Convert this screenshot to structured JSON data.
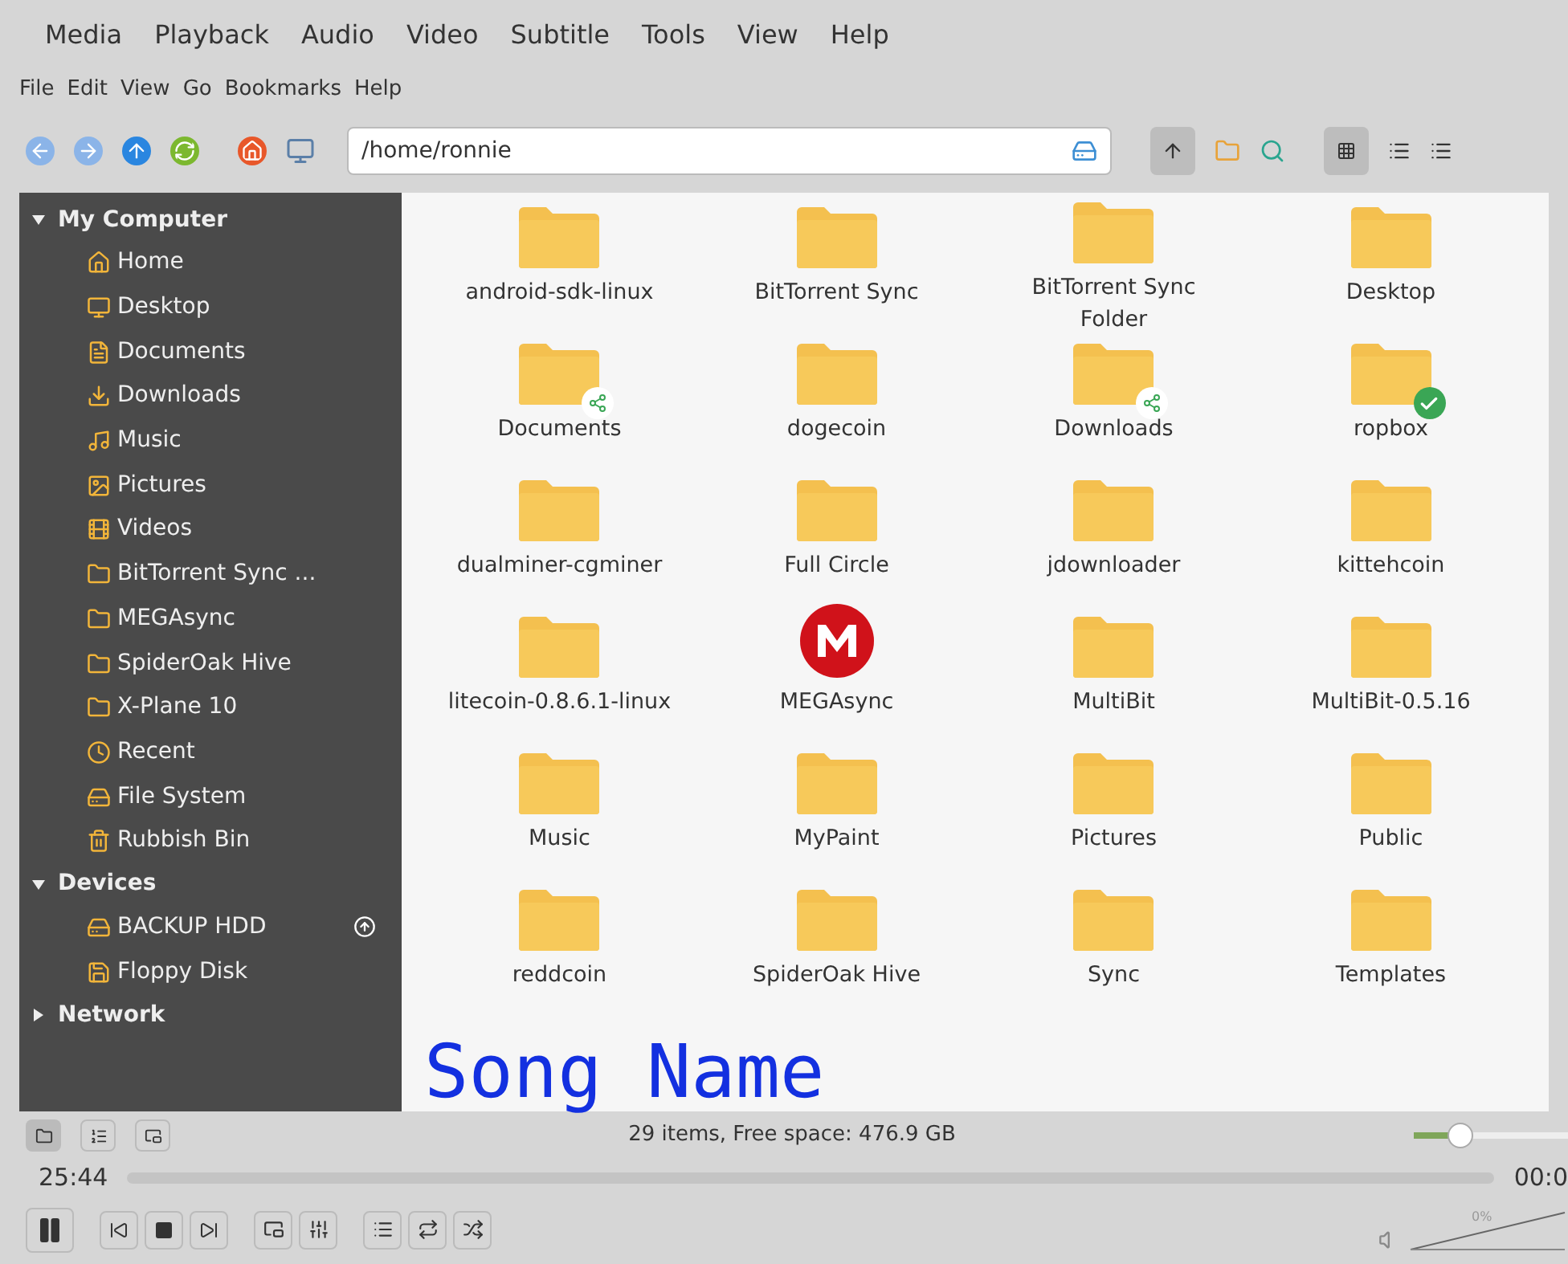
{
  "player_menu": [
    "Media",
    "Playback",
    "Audio",
    "Video",
    "Subtitle",
    "Tools",
    "View",
    "Help"
  ],
  "file_manager": {
    "menu": [
      "File",
      "Edit",
      "View",
      "Go",
      "Bookmarks",
      "Help"
    ],
    "location": "/home/ronnie",
    "sidebar": [
      {
        "label": "My Computer",
        "expanded": true,
        "children": [
          {
            "label": "Home"
          },
          {
            "label": "Desktop"
          },
          {
            "label": "Documents"
          },
          {
            "label": "Downloads"
          },
          {
            "label": "Music"
          },
          {
            "label": "Pictures"
          },
          {
            "label": "Videos"
          },
          {
            "label": "BitTorrent Sync ..."
          },
          {
            "label": "MEGAsync"
          },
          {
            "label": "SpiderOak Hive"
          },
          {
            "label": "X-Plane 10"
          },
          {
            "label": "Recent"
          },
          {
            "label": "File System"
          },
          {
            "label": "Rubbish Bin"
          }
        ]
      },
      {
        "label": "Devices",
        "expanded": true,
        "children": [
          {
            "label": "BACKUP HDD",
            "ejectable": true
          },
          {
            "label": "Floppy Disk",
            "ejectable": false
          }
        ]
      },
      {
        "label": "Network",
        "expanded": false
      }
    ],
    "items": [
      {
        "name": "android-sdk-linux",
        "kind": "folder"
      },
      {
        "name": "BitTorrent Sync",
        "kind": "folder"
      },
      {
        "name": "BitTorrent Sync Folder",
        "kind": "folder"
      },
      {
        "name": "Desktop",
        "kind": "folder"
      },
      {
        "name": "Documents",
        "kind": "folder",
        "shared": true
      },
      {
        "name": "dogecoin",
        "kind": "folder"
      },
      {
        "name": "Downloads",
        "kind": "folder",
        "shared": true
      },
      {
        "name": "ropbox",
        "kind": "folder",
        "synced": true
      },
      {
        "name": "dualminer-cgminer",
        "kind": "folder"
      },
      {
        "name": "Full Circle",
        "kind": "folder"
      },
      {
        "name": "jdownloader",
        "kind": "folder"
      },
      {
        "name": "kittehcoin",
        "kind": "folder"
      },
      {
        "name": "litecoin-0.8.6.1-linux",
        "kind": "folder"
      },
      {
        "name": "MEGAsync",
        "kind": "mega"
      },
      {
        "name": "MultiBit",
        "kind": "folder"
      },
      {
        "name": "MultiBit-0.5.16",
        "kind": "folder"
      },
      {
        "name": "Music",
        "kind": "folder"
      },
      {
        "name": "MyPaint",
        "kind": "folder"
      },
      {
        "name": "Pictures",
        "kind": "folder"
      },
      {
        "name": "Public",
        "kind": "folder"
      },
      {
        "name": "reddcoin",
        "kind": "folder"
      },
      {
        "name": "SpiderOak Hive",
        "kind": "folder"
      },
      {
        "name": "Sync",
        "kind": "folder"
      },
      {
        "name": "Templates",
        "kind": "folder"
      }
    ],
    "status": "29 items, Free space: 476.9 GB",
    "zoom": {
      "level": 0.3
    }
  },
  "subtitle": "Song Name",
  "elapsed": "25:44",
  "remaining": "00:0",
  "seek": {
    "level": 0.0
  },
  "volume": {
    "label": "0%",
    "level": 0.0
  }
}
